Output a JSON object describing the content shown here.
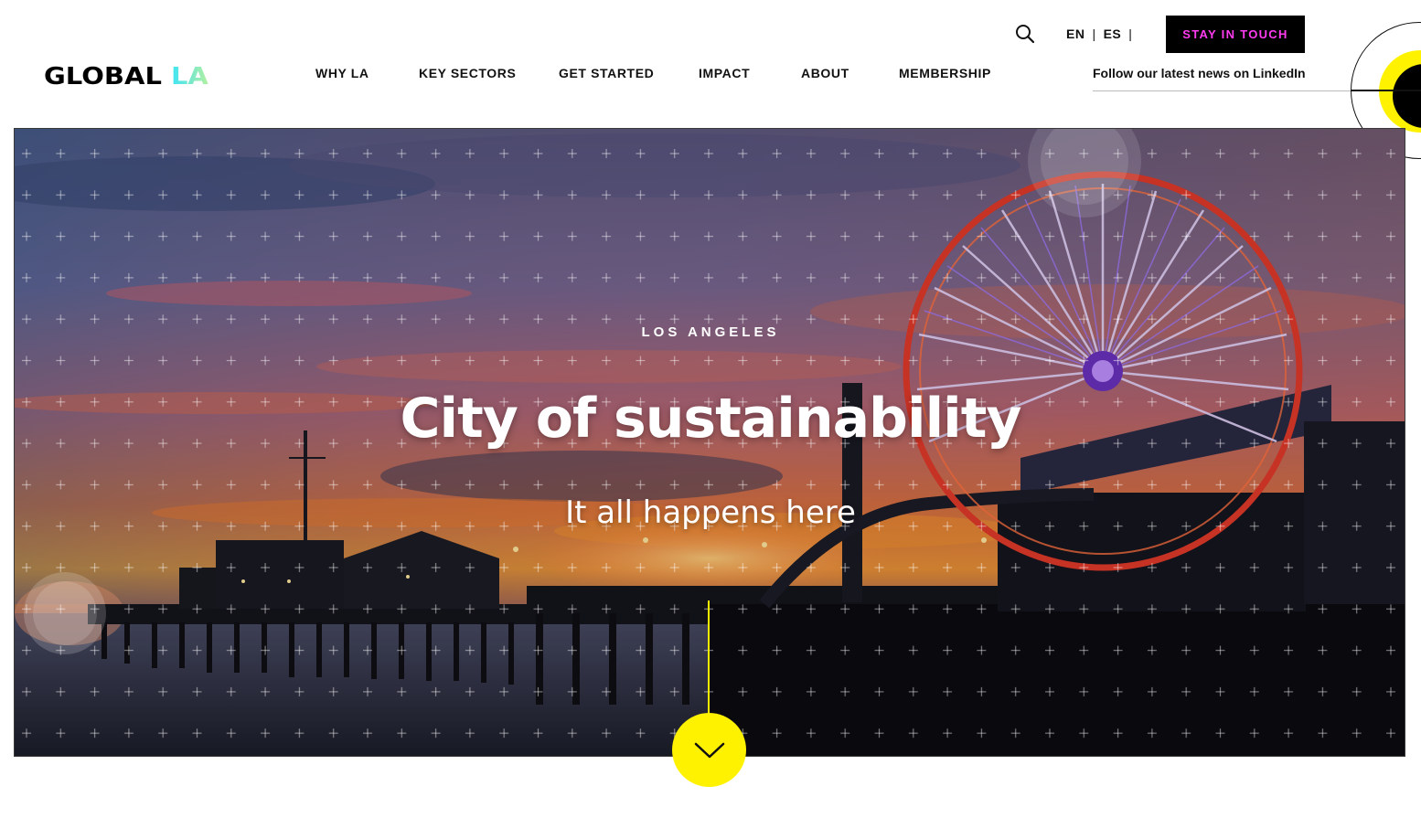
{
  "header": {
    "logo": {
      "word1": "GLOBAL",
      "word2": "LA"
    },
    "nav": [
      {
        "label": "WHY LA"
      },
      {
        "label": "KEY SECTORS"
      },
      {
        "label": "GET STARTED"
      },
      {
        "label": "IMPACT"
      },
      {
        "label": "ABOUT"
      },
      {
        "label": "MEMBERSHIP"
      }
    ],
    "search_icon": "search-icon",
    "languages": [
      "EN",
      "ES"
    ],
    "cta_label": "STAY IN TOUCH",
    "linkedin_text": "Follow our latest news on LinkedIn"
  },
  "hero": {
    "eyebrow": "LOS ANGELES",
    "title": "City of sustainability",
    "subtitle": "It all happens here",
    "scroll_icon": "chevron-down-icon"
  },
  "colors": {
    "accent_yellow": "#fff200",
    "cta_text": "#ff3cf0",
    "logo_gradient_start": "#3ee6f5",
    "logo_gradient_end": "#b4f0a0"
  }
}
